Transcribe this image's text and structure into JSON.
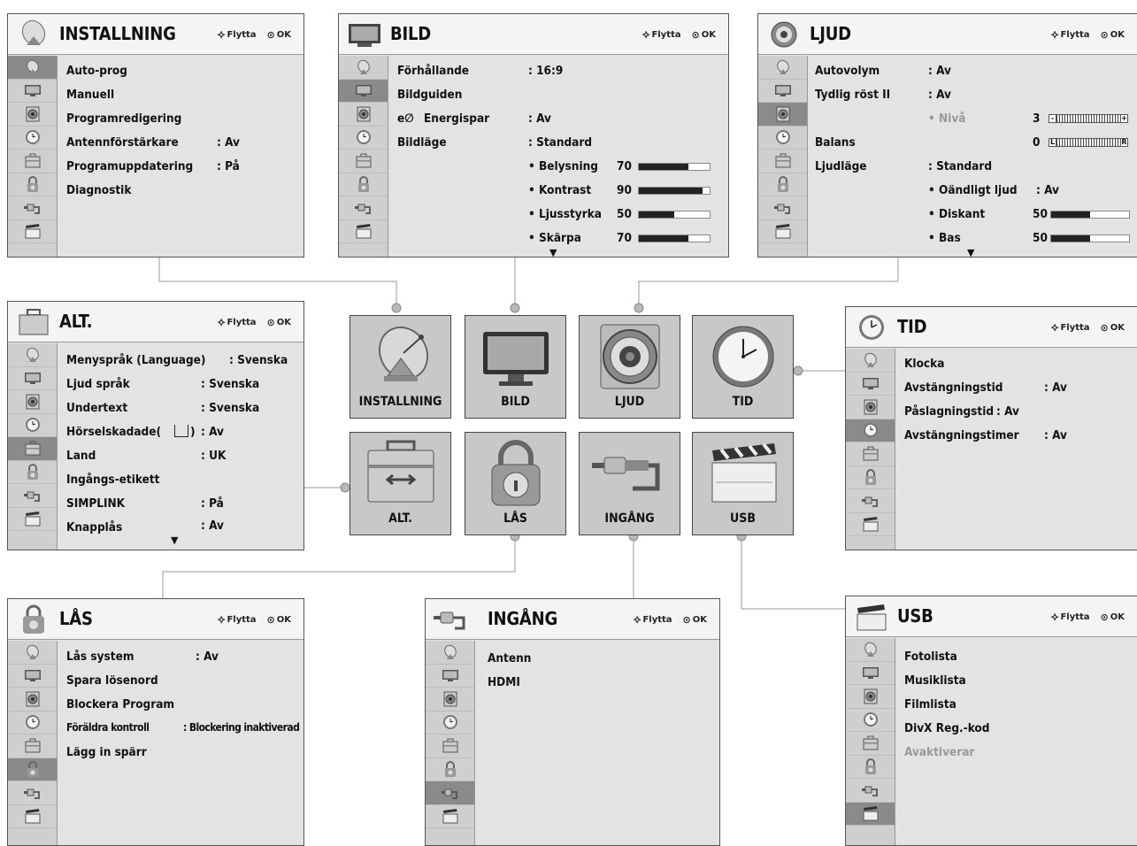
{
  "hint": {
    "move": "Flytta",
    "ok": "OK"
  },
  "tiles": [
    {
      "label": "INSTALLNING",
      "icon": "satellite-dish-icon"
    },
    {
      "label": "BILD",
      "icon": "tv-icon"
    },
    {
      "label": "LJUD",
      "icon": "speaker-icon"
    },
    {
      "label": "TID",
      "icon": "clock-icon"
    },
    {
      "label": "ALT.",
      "icon": "toolbox-icon"
    },
    {
      "label": "LÅS",
      "icon": "padlock-icon"
    },
    {
      "label": "INGÅNG",
      "icon": "av-plug-icon"
    },
    {
      "label": "USB",
      "icon": "clapperboard-icon"
    }
  ],
  "panels": {
    "installning": {
      "title": "INSTALLNING",
      "rows": [
        {
          "label": "Auto-prog"
        },
        {
          "label": "Manuell"
        },
        {
          "label": "Programredigering"
        },
        {
          "label": "Antennförstärkare",
          "value": ": Av"
        },
        {
          "label": "Programuppdatering",
          "value": ": På"
        },
        {
          "label": "Diagnostik"
        }
      ]
    },
    "bild": {
      "title": "BILD",
      "rows": [
        {
          "label": "Förhållande",
          "value": ": 16:9"
        },
        {
          "label": "Bildguiden"
        },
        {
          "label": "Energispar",
          "value": ": Av",
          "eco": "eco-icon"
        },
        {
          "label": "Bildläge",
          "value": ": Standard"
        }
      ],
      "levels": [
        {
          "label": "• Belysning",
          "value": "70",
          "level": 70
        },
        {
          "label": "• Kontrast",
          "value": "90",
          "level": 90
        },
        {
          "label": "• Ljusstyrka",
          "value": "50",
          "level": 50
        },
        {
          "label": "• Skärpa",
          "value": "70",
          "level": 70
        }
      ],
      "more": "▼"
    },
    "ljud": {
      "title": "LJUD",
      "rows": [
        {
          "label": "Autovolym",
          "value": ": Av"
        },
        {
          "label": "Tydlig röst II",
          "value": ": Av"
        },
        {
          "label": "Balans",
          "value": "0"
        },
        {
          "label": "Ljudläge",
          "value": ": Standard"
        }
      ],
      "nivaa": {
        "label": "• Nivå",
        "value": "3",
        "minus": "-",
        "plus": "+"
      },
      "balans_scale": {
        "l": "L",
        "r": "R"
      },
      "sub": [
        {
          "label": "• Oändligt ljud",
          "value": ": Av"
        }
      ],
      "levels": [
        {
          "label": "• Diskant",
          "value": "50",
          "level": 50
        },
        {
          "label": "• Bas",
          "value": "50",
          "level": 50
        }
      ],
      "more": "▼"
    },
    "tid": {
      "title": "TID",
      "rows": [
        {
          "label": "Klocka"
        },
        {
          "label": "Avstängningstid",
          "value": ": Av"
        },
        {
          "label": "Påslagningstid",
          "value": ": Av"
        },
        {
          "label": "Avstängningstimer",
          "value": ": Av"
        }
      ]
    },
    "alt": {
      "title": "ALT.",
      "rows": [
        {
          "label": "Menyspråk (Language)",
          "value": ": Svenska"
        },
        {
          "label": "Ljud språk",
          "value": ": Svenska"
        },
        {
          "label": "Undertext",
          "value": ": Svenska"
        },
        {
          "label": "Hörselskadade(",
          "value": ": Av",
          "subtitle_icon": "subtitle-icon",
          "after": ")"
        },
        {
          "label": "Land",
          "value": ": UK"
        },
        {
          "label": "Ingångs-etikett"
        },
        {
          "label": "SIMPLINK",
          "value": ": På"
        },
        {
          "label": "Knapplås",
          "value": ": Av"
        }
      ],
      "more": "▼"
    },
    "las": {
      "title": "LÅS",
      "rows": [
        {
          "label": "Lås system",
          "value": ": Av"
        },
        {
          "label": "Spara lösenord"
        },
        {
          "label": "Blockera Program"
        },
        {
          "label": "Föräldra kontroll",
          "value": ": Blockering inaktiverad"
        },
        {
          "label": "Lägg in spärr"
        }
      ]
    },
    "ingang": {
      "title": "INGÅNG",
      "rows": [
        {
          "label": "Antenn"
        },
        {
          "label": "HDMI"
        }
      ]
    },
    "usb": {
      "title": "USB",
      "rows": [
        {
          "label": "Fotolista"
        },
        {
          "label": "Musiklista"
        },
        {
          "label": "Filmlista"
        },
        {
          "label": "DivX Reg.-kod"
        },
        {
          "label": "Avaktiverar",
          "dim": true
        }
      ]
    }
  }
}
